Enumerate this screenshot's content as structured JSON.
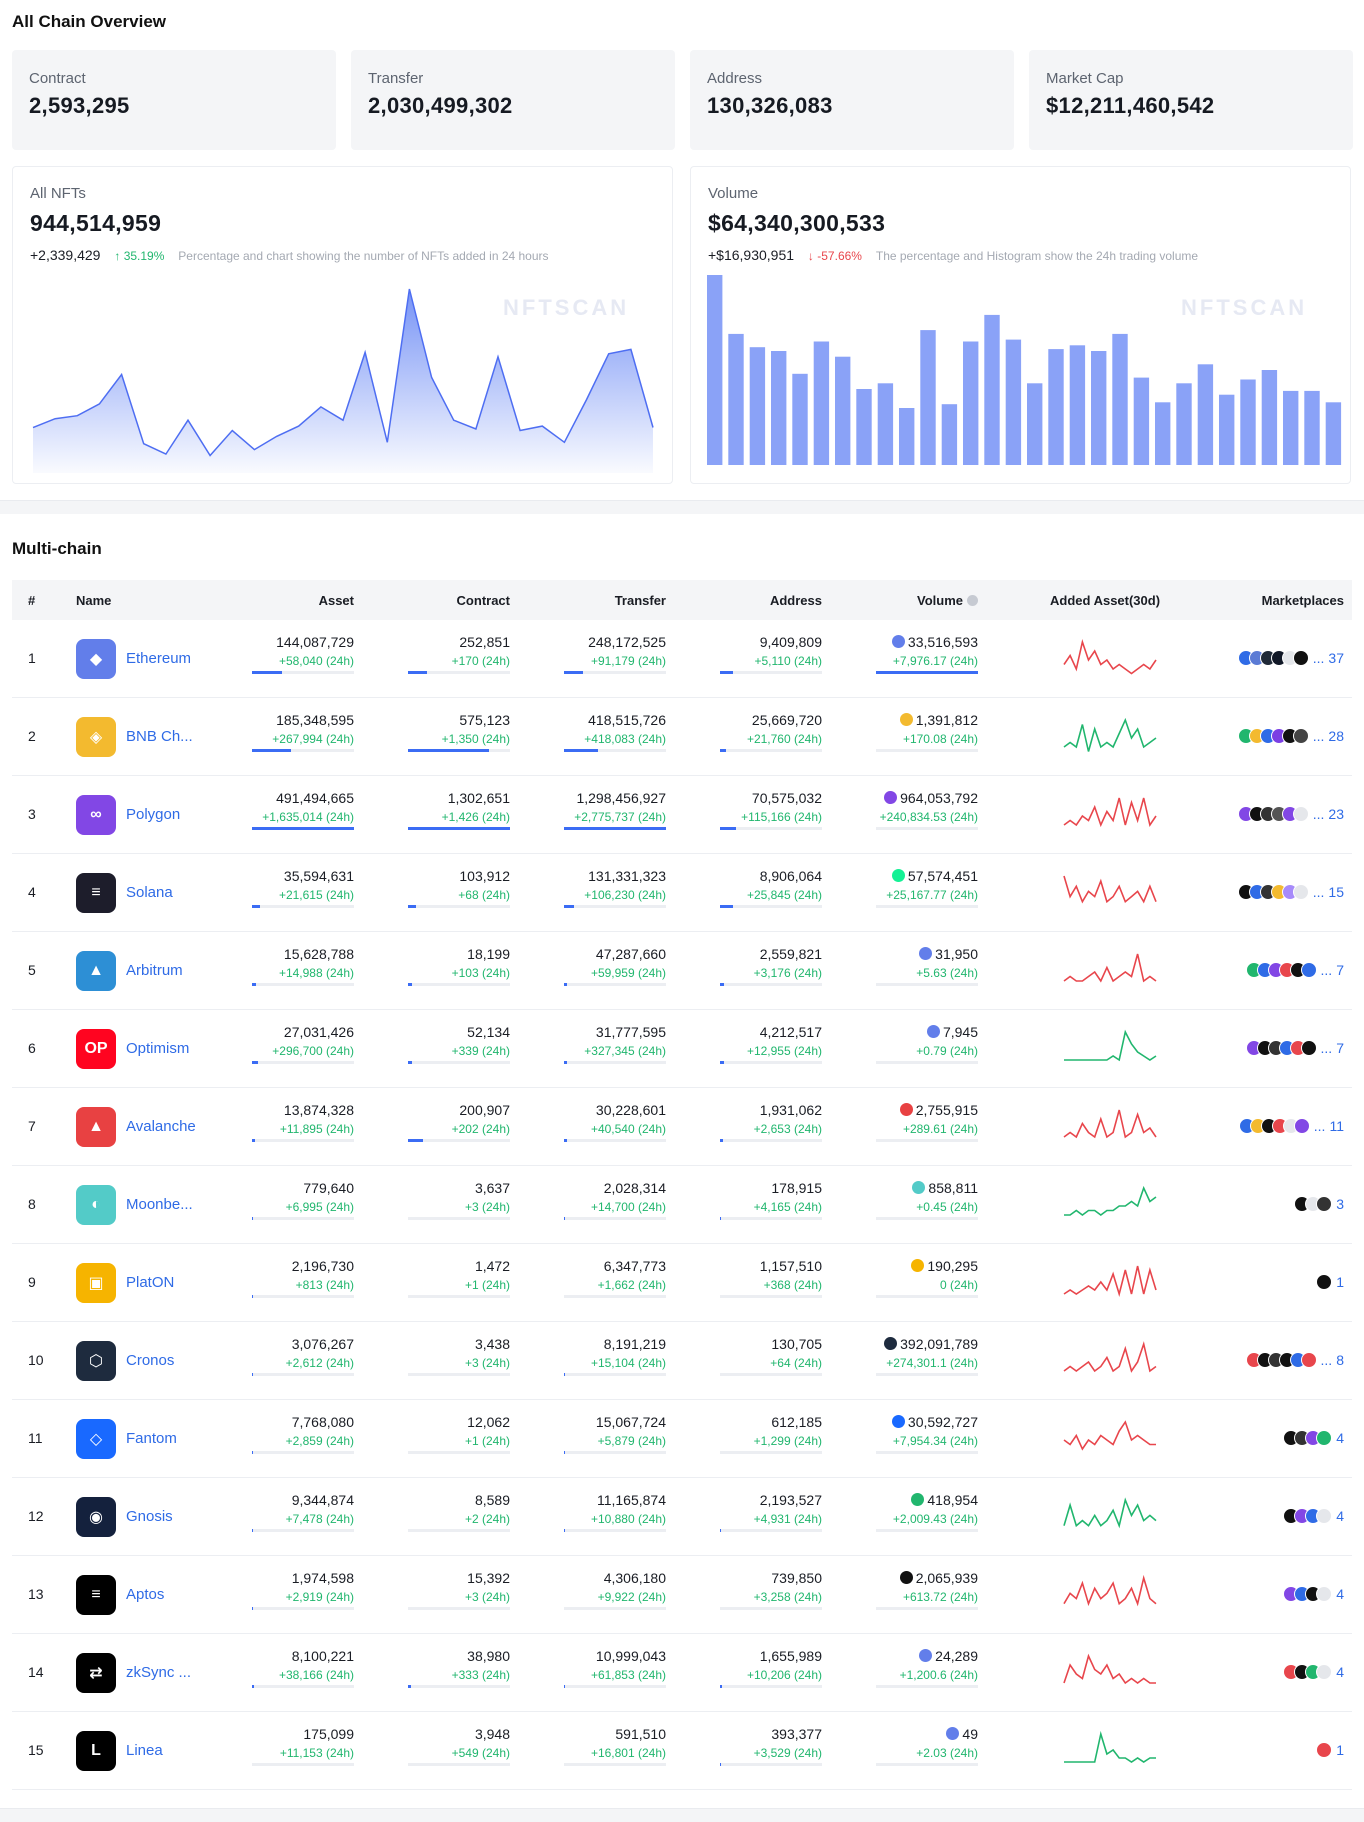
{
  "overview": {
    "title": "All Chain Overview",
    "stats": [
      {
        "label": "Contract",
        "value": "2,593,295"
      },
      {
        "label": "Transfer",
        "value": "2,030,499,302"
      },
      {
        "label": "Address",
        "value": "130,326,083"
      },
      {
        "label": "Market Cap",
        "value": "$12,211,460,542"
      }
    ],
    "nfts": {
      "label": "All NFTs",
      "value": "944,514,959",
      "delta": "+2,339,429",
      "pct": "35.19%",
      "note": "Percentage and chart showing the number of NFTs added in 24 hours",
      "watermark": "NFTSCAN",
      "series": [
        2,
        2.6,
        2.8,
        3.6,
        5.6,
        0.9,
        0.2,
        2.5,
        0.1,
        1.8,
        0.5,
        1.4,
        2.1,
        3.4,
        2.5,
        7.1,
        1.0,
        11.4,
        5.4,
        2.5,
        1.9,
        6.8,
        1.8,
        2.1,
        1.0,
        3.9,
        7.0,
        7.3,
        2.0
      ]
    },
    "volume": {
      "label": "Volume",
      "value": "$64,340,300,533",
      "delta": "+$16,930,951",
      "pct": "-57.66%",
      "note": "The percentage and Histogram show the 24h trading volume",
      "watermark": "NFTSCAN",
      "bars": [
        100,
        69,
        62,
        60,
        48,
        65,
        57,
        40,
        43,
        30,
        71,
        32,
        65,
        79,
        66,
        43,
        61,
        63,
        60,
        69,
        46,
        33,
        43,
        53,
        37,
        45,
        50,
        39,
        39,
        33
      ]
    }
  },
  "multichain": {
    "title": "Multi-chain",
    "headers": {
      "rank": "#",
      "name": "Name",
      "asset": "Asset",
      "contract": "Contract",
      "transfer": "Transfer",
      "address": "Address",
      "volume": "Volume",
      "added": "Added Asset(30d)",
      "marketplaces": "Marketplaces"
    },
    "rows": [
      {
        "rank": "1",
        "name": "Ethereum",
        "logo_color": "#627eea",
        "logo_glyph": "◆",
        "asset": "144,087,729",
        "asset_d": "+58,040 (24h)",
        "asset_p": 0.29,
        "contract": "252,851",
        "contract_d": "+170 (24h)",
        "contract_p": 0.19,
        "transfer": "248,172,525",
        "transfer_d": "+91,179 (24h)",
        "transfer_p": 0.19,
        "address": "9,409,809",
        "address_d": "+5,110 (24h)",
        "address_p": 0.13,
        "volume": "33,516,593",
        "volume_d": "+7,976.17 (24h)",
        "volume_p": 1.0,
        "vol_icon": "#627eea",
        "spark": "#e8464c",
        "spark_data": [
          3,
          5,
          2,
          8,
          4,
          6,
          3,
          4,
          2,
          3,
          2,
          1,
          2,
          3,
          2,
          4
        ],
        "market_count": "37",
        "market_colors": [
          "#2f6be6",
          "#5b7bd5",
          "#1f2937",
          "#111827",
          "#e5e7eb",
          "#111"
        ]
      },
      {
        "rank": "2",
        "name": "BNB Ch...",
        "logo_color": "#f3ba2f",
        "logo_glyph": "◈",
        "asset": "185,348,595",
        "asset_d": "+267,994 (24h)",
        "asset_p": 0.38,
        "contract": "575,123",
        "contract_d": "+1,350 (24h)",
        "contract_p": 0.79,
        "transfer": "418,515,726",
        "transfer_d": "+418,083 (24h)",
        "transfer_p": 0.33,
        "address": "25,669,720",
        "address_d": "+21,760 (24h)",
        "address_p": 0.06,
        "volume": "1,391,812",
        "volume_d": "+170.08 (24h)",
        "volume_p": 0.0,
        "vol_icon": "#f3ba2f",
        "spark": "#21b66e",
        "spark_data": [
          2,
          3,
          2,
          7,
          1,
          6,
          2,
          3,
          2,
          5,
          8,
          4,
          6,
          2,
          3,
          4
        ],
        "market_count": "28",
        "market_colors": [
          "#21b66e",
          "#f3ba2f",
          "#2f6be6",
          "#7b3fe4",
          "#111",
          "#444"
        ]
      },
      {
        "rank": "3",
        "name": "Polygon",
        "logo_color": "#8247e5",
        "logo_glyph": "∞",
        "asset": "491,494,665",
        "asset_d": "+1,635,014 (24h)",
        "asset_p": 1.0,
        "contract": "1,302,651",
        "contract_d": "+1,426 (24h)",
        "contract_p": 1.0,
        "transfer": "1,298,456,927",
        "transfer_d": "+2,775,737 (24h)",
        "transfer_p": 1.0,
        "address": "70,575,032",
        "address_d": "+115,166 (24h)",
        "address_p": 0.16,
        "volume": "964,053,792",
        "volume_d": "+240,834.53 (24h)",
        "volume_p": 0.0,
        "vol_icon": "#8247e5",
        "spark": "#e8464c",
        "spark_data": [
          2,
          3,
          2,
          4,
          3,
          6,
          2,
          5,
          3,
          8,
          2,
          7,
          3,
          8,
          2,
          4
        ],
        "market_count": "23",
        "market_colors": [
          "#8247e5",
          "#111",
          "#333",
          "#555",
          "#8247e5",
          "#e5e7eb"
        ]
      },
      {
        "rank": "4",
        "name": "Solana",
        "logo_color": "#1d1d2b",
        "logo_glyph": "≡",
        "asset": "35,594,631",
        "asset_d": "+21,615 (24h)",
        "asset_p": 0.08,
        "contract": "103,912",
        "contract_d": "+68 (24h)",
        "contract_p": 0.08,
        "transfer": "131,331,323",
        "transfer_d": "+106,230 (24h)",
        "transfer_p": 0.1,
        "address": "8,906,064",
        "address_d": "+25,845 (24h)",
        "address_p": 0.13,
        "volume": "57,574,451",
        "volume_d": "+25,167.77 (24h)",
        "volume_p": 0.0,
        "vol_icon": "#14f195",
        "spark": "#e8464c",
        "spark_data": [
          7,
          3,
          5,
          2,
          4,
          3,
          6,
          2,
          3,
          5,
          2,
          3,
          4,
          2,
          5,
          2
        ],
        "market_count": "15",
        "market_colors": [
          "#111",
          "#2f6be6",
          "#333",
          "#f3ba2f",
          "#a78bfa",
          "#e5e7eb"
        ]
      },
      {
        "rank": "5",
        "name": "Arbitrum",
        "logo_color": "#2d8fd5",
        "logo_glyph": "▲",
        "asset": "15,628,788",
        "asset_d": "+14,988 (24h)",
        "asset_p": 0.04,
        "contract": "18,199",
        "contract_d": "+103 (24h)",
        "contract_p": 0.04,
        "transfer": "47,287,660",
        "transfer_d": "+59,959 (24h)",
        "transfer_p": 0.03,
        "address": "2,559,821",
        "address_d": "+3,176 (24h)",
        "address_p": 0.04,
        "volume": "31,950",
        "volume_d": "+5.63 (24h)",
        "volume_p": 0.0,
        "vol_icon": "#627eea",
        "spark": "#e8464c",
        "spark_data": [
          2,
          3,
          2,
          2,
          3,
          4,
          2,
          5,
          2,
          3,
          4,
          3,
          8,
          2,
          3,
          2
        ],
        "market_count": "7",
        "market_colors": [
          "#21b66e",
          "#2f6be6",
          "#8247e5",
          "#e8464c",
          "#111",
          "#2f6be6"
        ]
      },
      {
        "rank": "6",
        "name": "Optimism",
        "logo_color": "#ff0420",
        "logo_glyph": "OP",
        "asset": "27,031,426",
        "asset_d": "+296,700 (24h)",
        "asset_p": 0.06,
        "contract": "52,134",
        "contract_d": "+339 (24h)",
        "contract_p": 0.04,
        "transfer": "31,777,595",
        "transfer_d": "+327,345 (24h)",
        "transfer_p": 0.03,
        "address": "4,212,517",
        "address_d": "+12,955 (24h)",
        "address_p": 0.04,
        "volume": "7,945",
        "volume_d": "+0.79 (24h)",
        "volume_p": 0.0,
        "vol_icon": "#627eea",
        "spark": "#21b66e",
        "spark_data": [
          2,
          2,
          2,
          2,
          2,
          2,
          2,
          2,
          3,
          2,
          9,
          6,
          4,
          3,
          2,
          3
        ],
        "market_count": "7",
        "market_colors": [
          "#8247e5",
          "#111",
          "#333",
          "#2f6be6",
          "#e8464c",
          "#111"
        ]
      },
      {
        "rank": "7",
        "name": "Avalanche",
        "logo_color": "#e84142",
        "logo_glyph": "▲",
        "asset": "13,874,328",
        "asset_d": "+11,895 (24h)",
        "asset_p": 0.03,
        "contract": "200,907",
        "contract_d": "+202 (24h)",
        "contract_p": 0.15,
        "transfer": "30,228,601",
        "transfer_d": "+40,540 (24h)",
        "transfer_p": 0.03,
        "address": "1,931,062",
        "address_d": "+2,653 (24h)",
        "address_p": 0.03,
        "volume": "2,755,915",
        "volume_d": "+289.61 (24h)",
        "volume_p": 0.0,
        "vol_icon": "#e84142",
        "spark": "#e8464c",
        "spark_data": [
          2,
          3,
          2,
          5,
          3,
          2,
          6,
          2,
          3,
          8,
          2,
          3,
          7,
          3,
          4,
          2
        ],
        "market_count": "11",
        "market_colors": [
          "#2f6be6",
          "#f3ba2f",
          "#111",
          "#e8464c",
          "#e5e7eb",
          "#8247e5"
        ]
      },
      {
        "rank": "8",
        "name": "Moonbe...",
        "logo_color": "#53cbc8",
        "logo_glyph": "◐",
        "asset": "779,640",
        "asset_d": "+6,995 (24h)",
        "asset_p": 0.01,
        "contract": "3,637",
        "contract_d": "+3 (24h)",
        "contract_p": 0.0,
        "transfer": "2,028,314",
        "transfer_d": "+14,700 (24h)",
        "transfer_p": 0.01,
        "address": "178,915",
        "address_d": "+4,165 (24h)",
        "address_p": 0.01,
        "volume": "858,811",
        "volume_d": "+0.45 (24h)",
        "volume_p": 0.0,
        "vol_icon": "#53cbc8",
        "spark": "#21b66e",
        "spark_data": [
          2,
          2,
          3,
          2,
          3,
          3,
          2,
          3,
          3,
          4,
          4,
          5,
          4,
          8,
          5,
          6
        ],
        "market_count": "3",
        "market_colors": [
          "#111",
          "#e5e7eb",
          "#333"
        ]
      },
      {
        "rank": "9",
        "name": "PlatON",
        "logo_color": "#f6b400",
        "logo_glyph": "▣",
        "asset": "2,196,730",
        "asset_d": "+813 (24h)",
        "asset_p": 0.01,
        "contract": "1,472",
        "contract_d": "+1 (24h)",
        "contract_p": 0.0,
        "transfer": "6,347,773",
        "transfer_d": "+1,662 (24h)",
        "transfer_p": 0.0,
        "address": "1,157,510",
        "address_d": "+368 (24h)",
        "address_p": 0.0,
        "volume": "190,295",
        "volume_d": "0 (24h)",
        "volume_p": 0.0,
        "vol_icon": "#f6b400",
        "spark": "#e8464c",
        "spark_data": [
          2,
          3,
          2,
          3,
          4,
          3,
          5,
          3,
          7,
          2,
          8,
          2,
          9,
          2,
          8,
          3
        ],
        "market_count": "1",
        "market_colors": [
          "#111"
        ]
      },
      {
        "rank": "10",
        "name": "Cronos",
        "logo_color": "#1e2b3e",
        "logo_glyph": "⬡",
        "asset": "3,076,267",
        "asset_d": "+2,612 (24h)",
        "asset_p": 0.01,
        "contract": "3,438",
        "contract_d": "+3 (24h)",
        "contract_p": 0.0,
        "transfer": "8,191,219",
        "transfer_d": "+15,104 (24h)",
        "transfer_p": 0.01,
        "address": "130,705",
        "address_d": "+64 (24h)",
        "address_p": 0.0,
        "volume": "392,091,789",
        "volume_d": "+274,301.1 (24h)",
        "volume_p": 0.0,
        "vol_icon": "#1e2b3e",
        "spark": "#e8464c",
        "spark_data": [
          2,
          3,
          2,
          3,
          4,
          2,
          3,
          5,
          2,
          3,
          7,
          2,
          4,
          8,
          2,
          3
        ],
        "market_count": "8",
        "market_colors": [
          "#e8464c",
          "#111",
          "#333",
          "#111",
          "#2f6be6",
          "#e8464c"
        ]
      },
      {
        "rank": "11",
        "name": "Fantom",
        "logo_color": "#1969ff",
        "logo_glyph": "◇",
        "asset": "7,768,080",
        "asset_d": "+2,859 (24h)",
        "asset_p": 0.01,
        "contract": "12,062",
        "contract_d": "+1 (24h)",
        "contract_p": 0.0,
        "transfer": "15,067,724",
        "transfer_d": "+5,879 (24h)",
        "transfer_p": 0.01,
        "address": "612,185",
        "address_d": "+1,299 (24h)",
        "address_p": 0.0,
        "volume": "30,592,727",
        "volume_d": "+7,954.34 (24h)",
        "volume_p": 0.0,
        "vol_icon": "#1969ff",
        "spark": "#e8464c",
        "spark_data": [
          4,
          3,
          5,
          2,
          4,
          3,
          5,
          4,
          3,
          6,
          8,
          4,
          5,
          4,
          3,
          3
        ],
        "market_count": "4",
        "market_colors": [
          "#111",
          "#333",
          "#8247e5",
          "#21b66e"
        ]
      },
      {
        "rank": "12",
        "name": "Gnosis",
        "logo_color": "#14213d",
        "logo_glyph": "◉",
        "asset": "9,344,874",
        "asset_d": "+7,478 (24h)",
        "asset_p": 0.01,
        "contract": "8,589",
        "contract_d": "+2 (24h)",
        "contract_p": 0.0,
        "transfer": "11,165,874",
        "transfer_d": "+10,880 (24h)",
        "transfer_p": 0.01,
        "address": "2,193,527",
        "address_d": "+4,931 (24h)",
        "address_p": 0.01,
        "volume": "418,954",
        "volume_d": "+2,009.43 (24h)",
        "volume_p": 0.0,
        "vol_icon": "#21b66e",
        "spark": "#21b66e",
        "spark_data": [
          2,
          6,
          2,
          3,
          2,
          4,
          2,
          3,
          5,
          2,
          7,
          4,
          6,
          3,
          4,
          3
        ],
        "market_count": "4",
        "market_colors": [
          "#111",
          "#8247e5",
          "#2f6be6",
          "#e5e7eb"
        ]
      },
      {
        "rank": "13",
        "name": "Aptos",
        "logo_color": "#000000",
        "logo_glyph": "≡",
        "asset": "1,974,598",
        "asset_d": "+2,919 (24h)",
        "asset_p": 0.01,
        "contract": "15,392",
        "contract_d": "+3 (24h)",
        "contract_p": 0.0,
        "transfer": "4,306,180",
        "transfer_d": "+9,922 (24h)",
        "transfer_p": 0.0,
        "address": "739,850",
        "address_d": "+3,258 (24h)",
        "address_p": 0.0,
        "volume": "2,065,939",
        "volume_d": "+613.72 (24h)",
        "volume_p": 0.0,
        "vol_icon": "#111111",
        "spark": "#e8464c",
        "spark_data": [
          2,
          4,
          3,
          6,
          2,
          5,
          3,
          4,
          6,
          2,
          3,
          5,
          2,
          7,
          3,
          2
        ],
        "market_count": "4",
        "market_colors": [
          "#8247e5",
          "#2f6be6",
          "#111",
          "#e5e7eb"
        ]
      },
      {
        "rank": "14",
        "name": "zkSync ...",
        "logo_color": "#000000",
        "logo_glyph": "⇄",
        "asset": "8,100,221",
        "asset_d": "+38,166 (24h)",
        "asset_p": 0.02,
        "contract": "38,980",
        "contract_d": "+333 (24h)",
        "contract_p": 0.03,
        "transfer": "10,999,043",
        "transfer_d": "+61,853 (24h)",
        "transfer_p": 0.01,
        "address": "1,655,989",
        "address_d": "+10,206 (24h)",
        "address_p": 0.02,
        "volume": "24,289",
        "volume_d": "+1,200.6 (24h)",
        "volume_p": 0.0,
        "vol_icon": "#627eea",
        "spark": "#e8464c",
        "spark_data": [
          2,
          6,
          4,
          3,
          8,
          5,
          4,
          6,
          3,
          4,
          2,
          3,
          2,
          3,
          2,
          2
        ],
        "market_count": "4",
        "market_colors": [
          "#e8464c",
          "#111",
          "#21b66e",
          "#e5e7eb"
        ]
      },
      {
        "rank": "15",
        "name": "Linea",
        "logo_color": "#000000",
        "logo_glyph": "L",
        "asset": "175,099",
        "asset_d": "+11,153 (24h)",
        "asset_p": 0.0,
        "contract": "3,948",
        "contract_d": "+549 (24h)",
        "contract_p": 0.0,
        "transfer": "591,510",
        "transfer_d": "+16,801 (24h)",
        "transfer_p": 0.0,
        "address": "393,377",
        "address_d": "+3,529 (24h)",
        "address_p": 0.01,
        "volume": "49",
        "volume_d": "+2.03 (24h)",
        "volume_p": 0.0,
        "vol_icon": "#627eea",
        "spark": "#21b66e",
        "spark_data": [
          2,
          2,
          2,
          2,
          2,
          2,
          9,
          4,
          5,
          3,
          3,
          2,
          3,
          2,
          3,
          3
        ],
        "market_count": "1",
        "market_colors": [
          "#e8464c"
        ]
      }
    ]
  }
}
